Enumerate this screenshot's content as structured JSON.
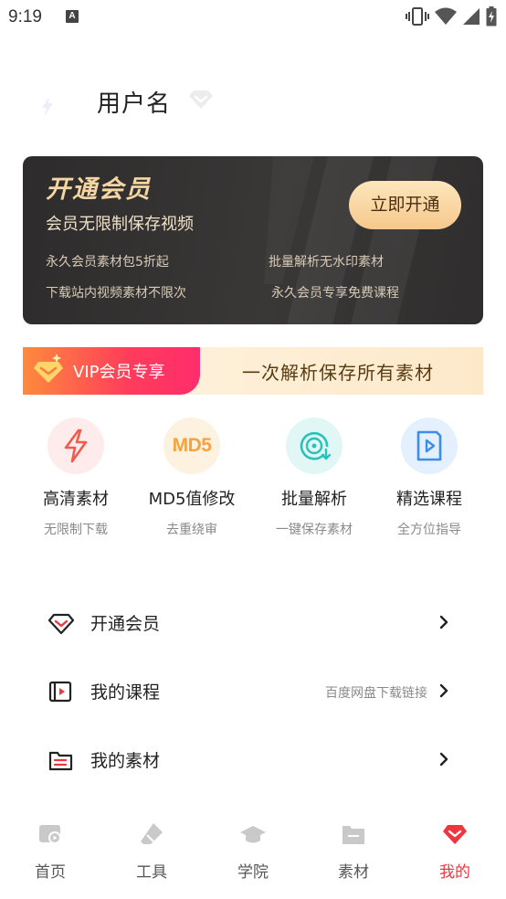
{
  "status_bar": {
    "time": "9:19",
    "notification_letter": "A"
  },
  "profile": {
    "username": "用户名"
  },
  "vip_card": {
    "title": "开通会员",
    "subtitle": "会员无限制保存视频",
    "button": "立即开通",
    "benefits": [
      "永久会员素材包5折起",
      "批量解析无水印素材",
      "下载站内视频素材不限次",
      "永久会员专享免费课程"
    ]
  },
  "promo": {
    "label": "VIP会员专享",
    "text": "一次解析保存所有素材"
  },
  "features": [
    {
      "title": "高清素材",
      "subtitle": "无限制下载",
      "icon": "lightning-icon",
      "icon_text": ""
    },
    {
      "title": "MD5值修改",
      "subtitle": "去重绕审",
      "icon": "md5-icon",
      "icon_text": "MD5"
    },
    {
      "title": "批量解析",
      "subtitle": "一键保存素材",
      "icon": "disc-download-icon",
      "icon_text": ""
    },
    {
      "title": "精选课程",
      "subtitle": "全方位指导",
      "icon": "video-book-icon",
      "icon_text": ""
    }
  ],
  "menu": [
    {
      "label": "开通会员",
      "note": "",
      "icon": "diamond-icon"
    },
    {
      "label": "我的课程",
      "note": "百度网盘下载链接",
      "icon": "video-course-icon"
    },
    {
      "label": "我的素材",
      "note": "",
      "icon": "folder-icon"
    }
  ],
  "tabs": [
    {
      "label": "首页",
      "icon": "home-icon",
      "active": false
    },
    {
      "label": "工具",
      "icon": "eraser-icon",
      "active": false
    },
    {
      "label": "学院",
      "icon": "graduation-cap-icon",
      "active": false
    },
    {
      "label": "素材",
      "icon": "folder-icon",
      "active": false
    },
    {
      "label": "我的",
      "icon": "gem-icon",
      "active": true
    }
  ],
  "colors": {
    "accent": "#f0353f",
    "gold": "#f5d6a3",
    "card_bg": "#2d2b2b",
    "md5_orange": "#f4a340",
    "teal": "#2ac1b8",
    "blue": "#3b8ee8"
  }
}
